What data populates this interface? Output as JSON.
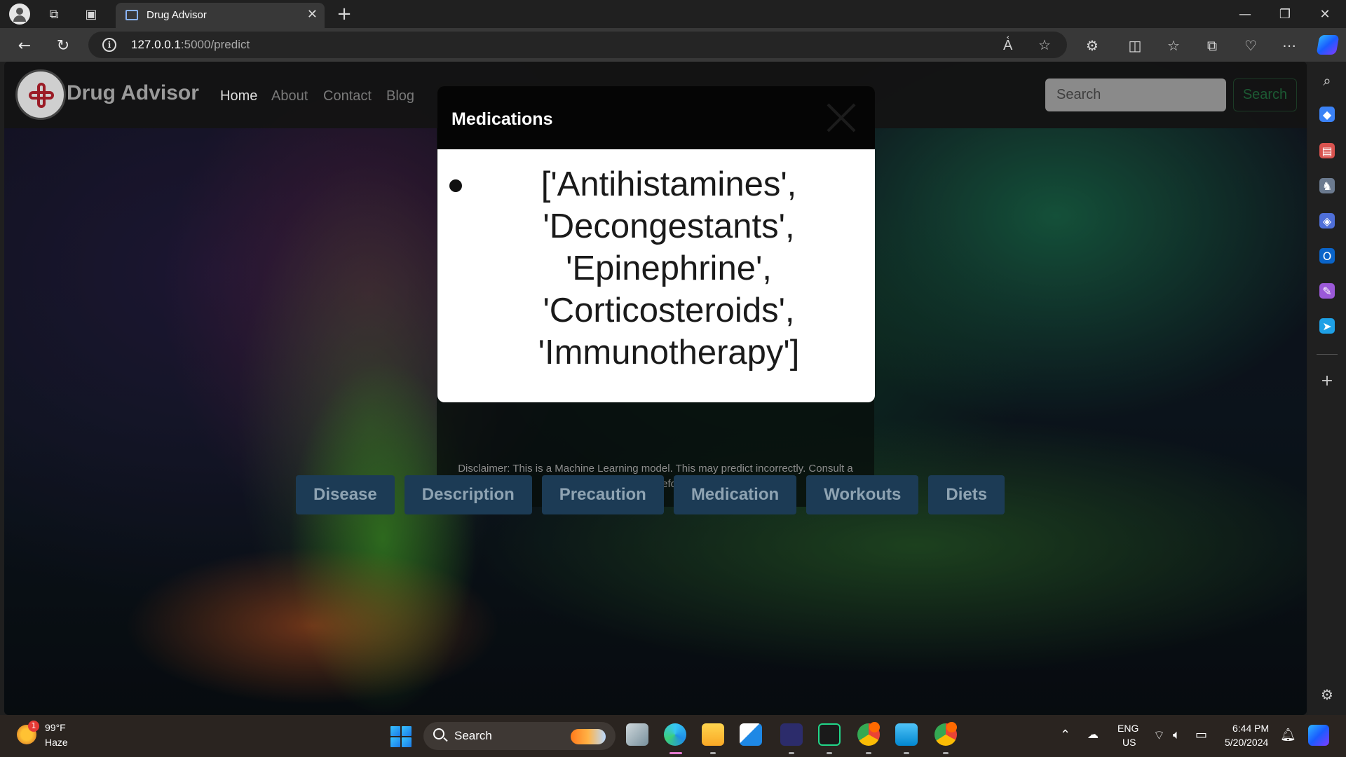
{
  "browser": {
    "tab_title": "Drug Advisor",
    "url_host": "127.0.0.1",
    "url_path": ":5000/predict"
  },
  "site": {
    "brand": "Drug Advisor",
    "nav": [
      "Home",
      "About",
      "Contact",
      "Blog"
    ],
    "search_placeholder": "Search",
    "search_button": "Search",
    "disclaimer": "Disclaimer: This is a Machine Learning model. This may predict incorrectly. Consult a Doctor before.",
    "result_buttons": [
      "Disease",
      "Description",
      "Precaution",
      "Medication",
      "Workouts",
      "Diets"
    ]
  },
  "modal": {
    "title": "Medications",
    "items": [
      "['Antihistamines', 'Decongestants', 'Epinephrine', 'Corticosteroids', 'Immunotherapy']"
    ]
  },
  "taskbar": {
    "weather_temp": "99°F",
    "weather_desc": "Haze",
    "weather_badge": "1",
    "search_label": "Search",
    "lang_1": "ENG",
    "lang_2": "US",
    "time": "6:44 PM",
    "date": "5/20/2024"
  },
  "colors": {
    "result_button_bg": "#1c3b55",
    "accent_green": "#1c5a33",
    "logo_red": "#9b1c26"
  }
}
